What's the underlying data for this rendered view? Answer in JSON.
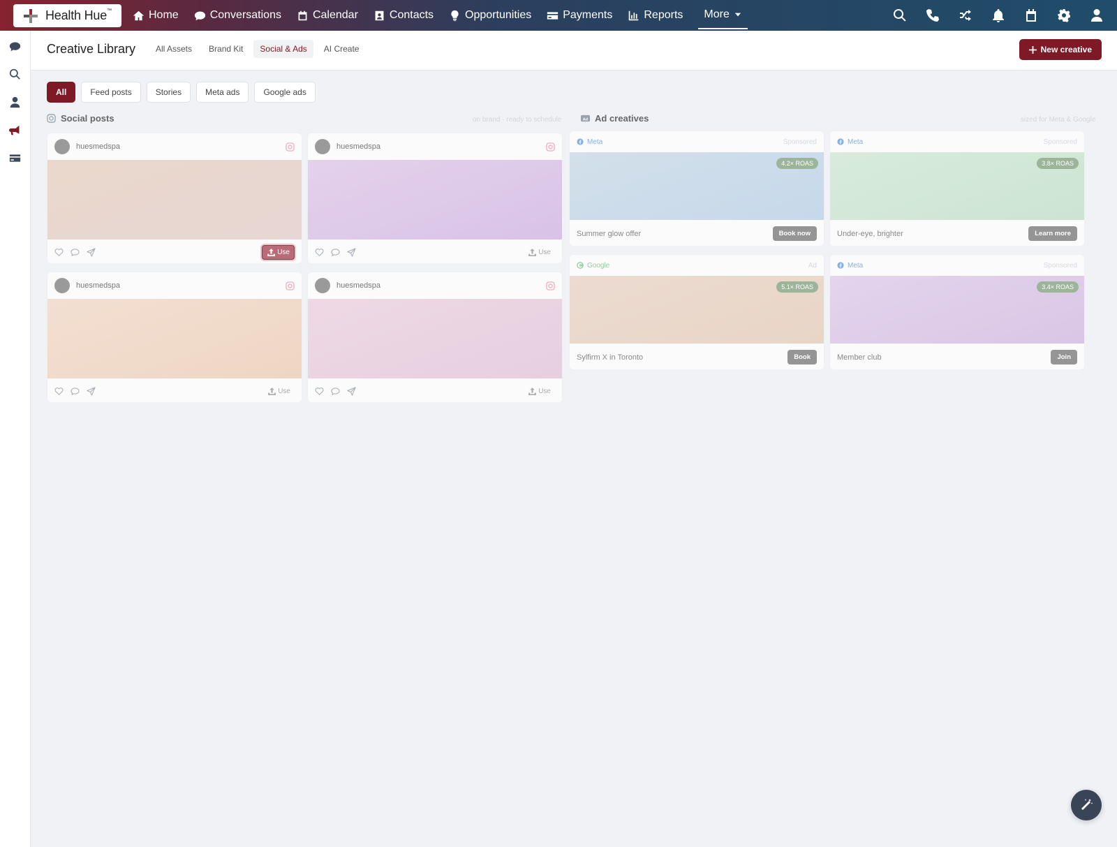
{
  "brand": {
    "name": "Health Hue",
    "mark": "™"
  },
  "nav": [
    {
      "label": "Home",
      "icon": "home-icon"
    },
    {
      "label": "Conversations",
      "icon": "chat-icon"
    },
    {
      "label": "Calendar",
      "icon": "calendar-icon"
    },
    {
      "label": "Contacts",
      "icon": "contact-card-icon"
    },
    {
      "label": "Opportunities",
      "icon": "lightbulb-icon"
    },
    {
      "label": "Payments",
      "icon": "credit-card-icon"
    },
    {
      "label": "Reports",
      "icon": "bar-chart-icon"
    }
  ],
  "nav_more": "More",
  "header": {
    "title": "Creative Library",
    "tabs": [
      "All Assets",
      "Brand Kit",
      "Social & Ads",
      "AI Create"
    ],
    "active_tab": "Social & Ads",
    "new_button": "New creative"
  },
  "filters": {
    "items": [
      "All",
      "Feed posts",
      "Stories",
      "Meta ads",
      "Google ads"
    ],
    "active": "All"
  },
  "social": {
    "title": "Social posts",
    "hint": "on brand · ready to schedule",
    "posts": [
      {
        "handle": "huesmedspa",
        "use": "Use",
        "color": "#ead8cc",
        "color2": "#e7d6d3"
      },
      {
        "handle": "huesmedspa",
        "use": "Use",
        "color": "#e4d1ec",
        "color2": "#d8c3e6"
      },
      {
        "handle": "huesmedspa",
        "use": "Use",
        "color": "#f3dfd2",
        "color2": "#eed6c3"
      },
      {
        "handle": "huesmedspa",
        "use": "Use",
        "color": "#eed9e5",
        "color2": "#e6cfe0"
      }
    ]
  },
  "ads": {
    "title": "Ad creatives",
    "hint": "sized for Meta & Google",
    "items": [
      {
        "platform": "Meta",
        "label": "Sponsored",
        "roas": "4.2× ROAS",
        "title": "Summer glow offer",
        "cta": "Book now",
        "color": "#d3e0ea",
        "color2": "#c6d8ea"
      },
      {
        "platform": "Meta",
        "label": "Sponsored",
        "roas": "3.8× ROAS",
        "title": "Under-eye, brighter",
        "cta": "Learn more",
        "color": "#d8ebdc",
        "color2": "#cde4d2"
      },
      {
        "platform": "Google",
        "label": "Ad",
        "roas": "5.1× ROAS",
        "title": "Sylfirm X in Toronto",
        "cta": "Book",
        "color": "#ecdbd1",
        "color2": "#e8d5c6"
      },
      {
        "platform": "Meta",
        "label": "Sponsored",
        "roas": "3.4× ROAS",
        "title": "Member club",
        "cta": "Join",
        "color": "#e4d4ec",
        "color2": "#d9c6e6"
      }
    ]
  },
  "colors": {
    "accent": "#7d1a26",
    "topbar_start": "#86232f",
    "topbar_end": "#1f4d6a"
  }
}
